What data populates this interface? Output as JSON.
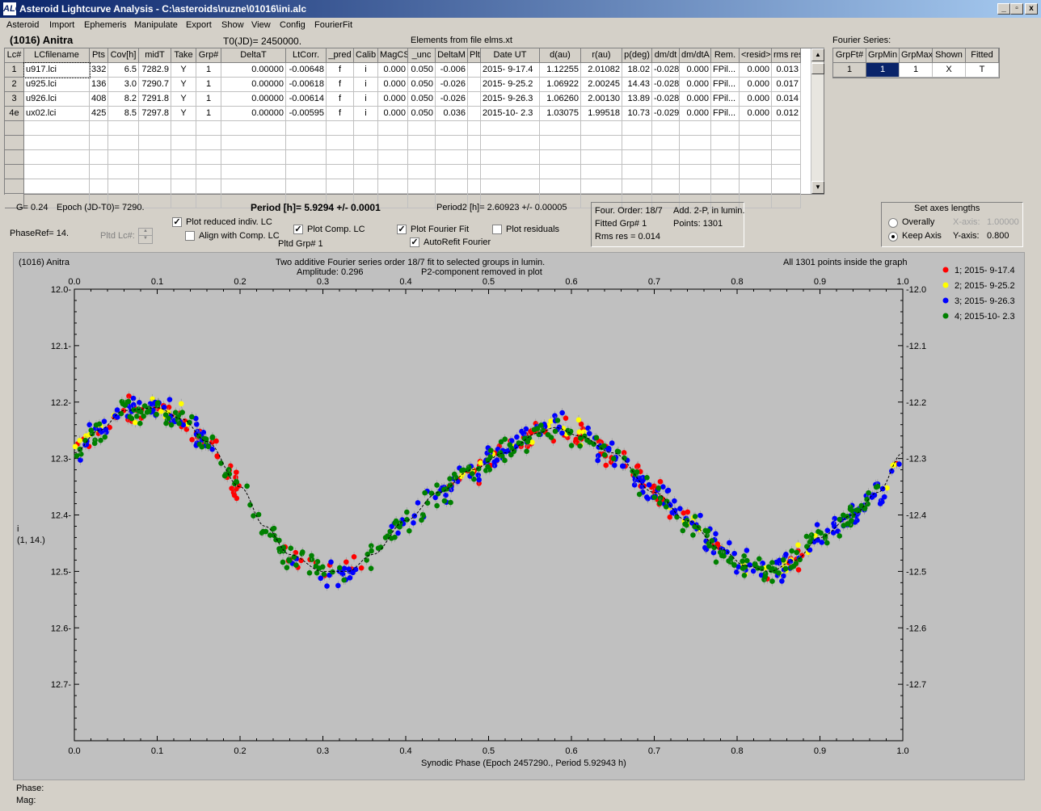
{
  "window": {
    "title": "Asteroid Lightcurve Analysis - C:\\asteroids\\ruzne\\01016\\ini.alc",
    "icon": "ALC",
    "btn_min": "_",
    "btn_restore": "▫",
    "btn_close": "x"
  },
  "menu": [
    "Asteroid",
    "Import",
    "Ephemeris",
    "Manipulate",
    "Export",
    "Show",
    "View",
    "Config",
    "FourierFit"
  ],
  "header": {
    "asteroid": "(1016) Anitra",
    "t0": "T0(JD)= 2450000.",
    "elements": "Elements from file elms.xt",
    "fourier_series_label": "Fourier Series:"
  },
  "table": {
    "columns": [
      "Lc#",
      "LCfilename",
      "Pts",
      "Cov[h]",
      "midT",
      "Take",
      "Grp#",
      "DeltaT",
      "LtCorr.",
      "_pred",
      "Calib",
      "MagCS",
      "_unc",
      "DeltaM",
      "Plt",
      "Date UT",
      "d(au)",
      "r(au)",
      "p(deg)",
      "dm/dt",
      "dm/dtA",
      "Rem.",
      "<resid>",
      "rms res"
    ],
    "rows": [
      [
        "1",
        "u917.lci",
        "332",
        "6.5",
        "7282.9",
        "Y",
        "1",
        "0.00000",
        "-0.00648",
        "f",
        "i",
        "0.000",
        "0.050",
        "-0.006",
        "",
        "2015- 9-17.4",
        "1.12255",
        "2.01082",
        "18.02",
        "-0.028",
        "0.000",
        "FPil...",
        "0.000",
        "0.013"
      ],
      [
        "2",
        "u925.lci",
        "136",
        "3.0",
        "7290.7",
        "Y",
        "1",
        "0.00000",
        "-0.00618",
        "f",
        "i",
        "0.000",
        "0.050",
        "-0.026",
        "",
        "2015- 9-25.2",
        "1.06922",
        "2.00245",
        "14.43",
        "-0.028",
        "0.000",
        "FPil...",
        "0.000",
        "0.017"
      ],
      [
        "3",
        "u926.lci",
        "408",
        "8.2",
        "7291.8",
        "Y",
        "1",
        "0.00000",
        "-0.00614",
        "f",
        "i",
        "0.000",
        "0.050",
        "-0.026",
        "",
        "2015- 9-26.3",
        "1.06260",
        "2.00130",
        "13.89",
        "-0.028",
        "0.000",
        "FPil...",
        "0.000",
        "0.014"
      ],
      [
        "4e",
        "ux02.lci",
        "425",
        "8.5",
        "7297.8",
        "Y",
        "1",
        "0.00000",
        "-0.00595",
        "f",
        "i",
        "0.000",
        "0.050",
        "0.036",
        "",
        "2015-10- 2.3",
        "1.03075",
        "1.99518",
        "10.73",
        "-0.029",
        "0.000",
        "FPil...",
        "0.000",
        "0.012"
      ]
    ]
  },
  "fourier_table": {
    "columns": [
      "GrpFt#",
      "GrpMin",
      "GrpMax",
      "Shown",
      "Fitted"
    ],
    "row": [
      "1",
      "1",
      "1",
      "X",
      "T"
    ]
  },
  "info": {
    "g": "G= 0.24",
    "epoch": "Epoch (JD-T0)= 7290.",
    "period": "Period [h]= 5.9294 +/- 0.0001",
    "period2": "Period2 [h]= 2.60923 +/- 0.00005",
    "phaseref": "PhaseRef= 14.",
    "pltd_lc": "Pltd Lc#:",
    "pltd_grp": "Pltd Grp#  1",
    "cb_reduced": "Plot reduced indiv. LC",
    "cb_align": "Align with Comp. LC",
    "cb_comp": "Plot Comp. LC",
    "cb_fourier": "Plot Fourier Fit",
    "cb_resid": "Plot residuals",
    "cb_autorefit": "AutoRefit Fourier",
    "four_order": "Four. Order: 18/7",
    "add2p": "Add. 2-P, in lumin.",
    "fitted_grp": "Fitted Grp# 1",
    "points": "Points: 1301",
    "rms": "Rms res     = 0.014"
  },
  "axes_box": {
    "title": "Set axes lengths",
    "overally": "Overally",
    "keep_axis": "Keep Axis",
    "xaxis_label": "X-axis:",
    "xaxis_val": "1.00000",
    "yaxis_label": "Y-axis:",
    "yaxis_val": "0.800"
  },
  "plot": {
    "name": "(1016) Anitra",
    "subtitle1": "Two additive Fourier series order 18/7 fit to selected groups in lumin.",
    "amplitude": "Amplitude: 0.296",
    "p2note": "P2-component removed in plot",
    "inside": "All 1301 points inside the graph",
    "ylabel1": "i",
    "ylabel2": "(1, 14.)",
    "xlabel": "Synodic Phase (Epoch 2457290., Period 5.92943 h)"
  },
  "chart_data": {
    "type": "scatter",
    "x_range": [
      0,
      1
    ],
    "y_range": [
      12.0,
      12.8
    ],
    "y_inverted": true,
    "x_ticks": [
      "0.0",
      "0.1",
      "0.2",
      "0.3",
      "0.4",
      "0.5",
      "0.6",
      "0.7",
      "0.8",
      "0.9",
      "1.0"
    ],
    "y_ticks": [
      "12.0",
      "12.1",
      "12.2",
      "12.3",
      "12.4",
      "12.5",
      "12.6",
      "12.7"
    ],
    "series": [
      {
        "name": "1; 2015- 9-17.4",
        "color": "#ff0000"
      },
      {
        "name": "2; 2015- 9-25.2",
        "color": "#ffff00"
      },
      {
        "name": "3; 2015- 9-26.3",
        "color": "#0000ff"
      },
      {
        "name": "4; 2015-10- 2.3",
        "color": "#008000"
      }
    ],
    "fit_curve": [
      [
        0.0,
        12.29
      ],
      [
        0.03,
        12.25
      ],
      [
        0.06,
        12.215
      ],
      [
        0.1,
        12.21
      ],
      [
        0.13,
        12.23
      ],
      [
        0.16,
        12.27
      ],
      [
        0.2,
        12.35
      ],
      [
        0.23,
        12.42
      ],
      [
        0.26,
        12.47
      ],
      [
        0.3,
        12.5
      ],
      [
        0.33,
        12.5
      ],
      [
        0.36,
        12.47
      ],
      [
        0.4,
        12.41
      ],
      [
        0.44,
        12.36
      ],
      [
        0.48,
        12.32
      ],
      [
        0.52,
        12.29
      ],
      [
        0.56,
        12.255
      ],
      [
        0.58,
        12.245
      ],
      [
        0.61,
        12.26
      ],
      [
        0.65,
        12.29
      ],
      [
        0.7,
        12.36
      ],
      [
        0.74,
        12.41
      ],
      [
        0.78,
        12.46
      ],
      [
        0.81,
        12.49
      ],
      [
        0.84,
        12.5
      ],
      [
        0.87,
        12.48
      ],
      [
        0.9,
        12.44
      ],
      [
        0.94,
        12.4
      ],
      [
        0.97,
        12.36
      ],
      [
        1.0,
        12.29
      ]
    ],
    "point_scatter": 0.025
  },
  "status": {
    "phase": "Phase:",
    "mag": "Mag:"
  }
}
